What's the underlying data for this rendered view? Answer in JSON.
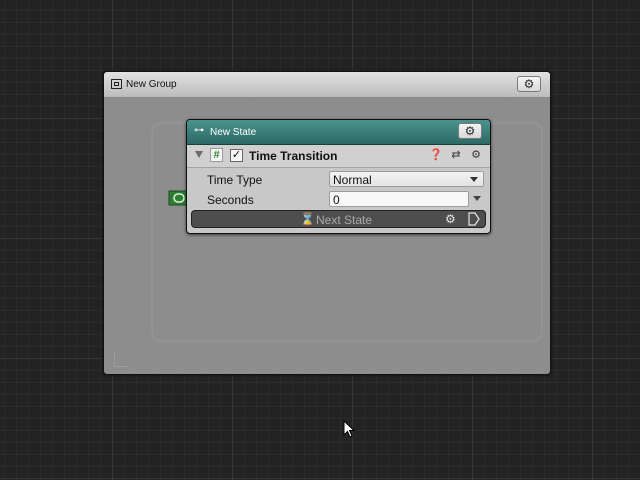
{
  "group": {
    "title": "New Group",
    "gear_icon": "gear-icon"
  },
  "state": {
    "title": "New State",
    "behaviour": {
      "title": "Time Transition",
      "icons": [
        "foldout-icon",
        "hash-script-icon",
        "help-icon",
        "preset-icon",
        "gear-icon"
      ],
      "enabled": true,
      "fields": {
        "time_type_label": "Time Type",
        "time_type_value": "Normal",
        "seconds_label": "Seconds",
        "seconds_value": "0"
      },
      "transition": {
        "label": "Next State",
        "icon": "hourglass-icon"
      }
    }
  },
  "colors": {
    "canvas": "#232323",
    "group_body": "#8d8d8d",
    "state_header": "#3b7f7a",
    "in_port": "#2e7d32",
    "transition_bar": "#4e4e4e"
  }
}
